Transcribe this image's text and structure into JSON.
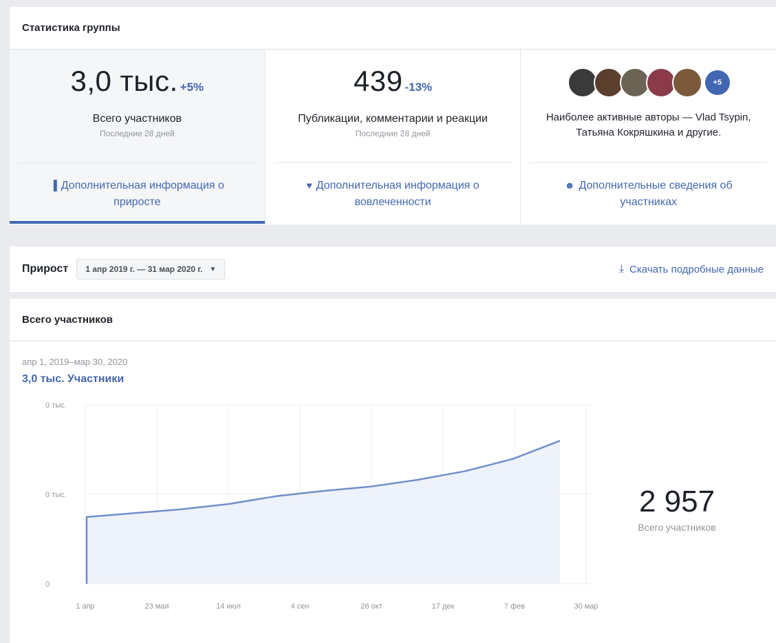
{
  "stats": {
    "title": "Статистика группы",
    "members": {
      "value": "3,0 тыс.",
      "delta": "+5%",
      "label": "Всего участников",
      "period": "Последние 28 дней",
      "link": "Дополнительная информация о приросте"
    },
    "posts": {
      "value": "439",
      "delta": "-13%",
      "label": "Публикации, комментарии и реакции",
      "period": "Последние 28 дней",
      "link": "Дополнительная информация о вовлеченности"
    },
    "authors": {
      "label": "Наиболее активные авторы — Vlad Tsypin, Татьяна Кокряшкина и другие.",
      "more": "+5",
      "link": "Дополнительные сведения об участниках"
    }
  },
  "growth": {
    "title": "Прирост",
    "date_range": "1 апр 2019 г. — 31 мар 2020 г.",
    "download": "Скачать подробные данные"
  },
  "members_card": {
    "title": "Всего участников",
    "range": "апр 1, 2019–мар 30, 2020",
    "total_link": "3,0 тыс. Участники",
    "side_value": "2 957",
    "side_label": "Всего участников"
  },
  "colors": {
    "accent": "#4267b2",
    "line": "#6f8fcb",
    "area": "#eef2fa"
  },
  "chart_data": {
    "type": "area",
    "x": [
      "1 апр",
      "23 мая",
      "14 июл",
      "4 сен",
      "26 окт",
      "17 дек",
      "7 фев",
      "30 мар"
    ],
    "y_ticks": [
      "0",
      "0 тыс.",
      "0 тыс."
    ],
    "ylim": [
      0,
      3700
    ],
    "series": [
      {
        "values": [
          0,
          1380,
          1460,
          1540,
          1650,
          1810,
          1920,
          2010,
          2150,
          2330,
          2580,
          2957
        ]
      }
    ]
  }
}
